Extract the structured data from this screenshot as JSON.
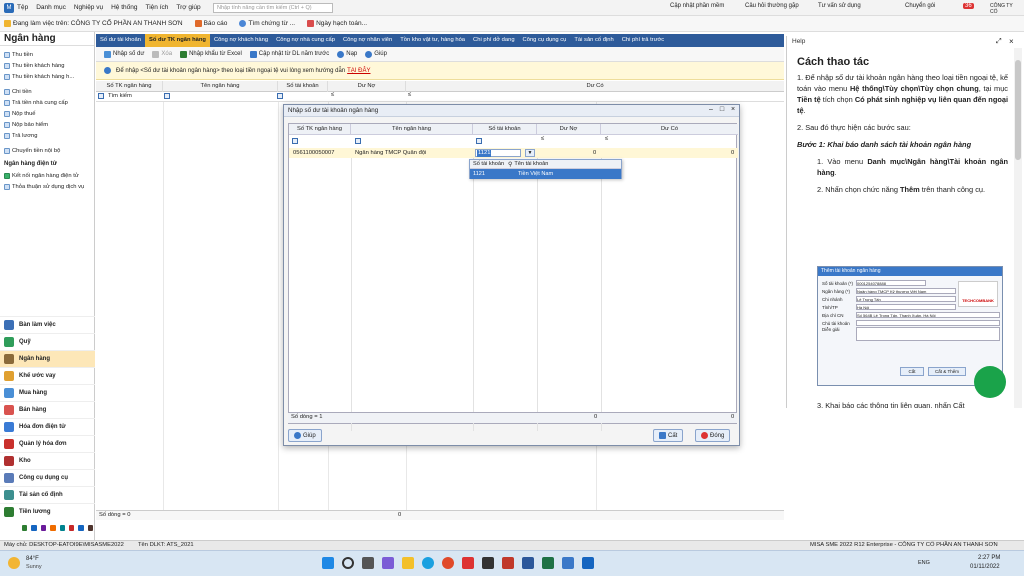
{
  "topbar": {
    "menu": [
      "Tệp",
      "Danh mục",
      "Nghiệp vụ",
      "Hệ thống",
      "Tiện ích",
      "Trợ giúp"
    ],
    "search_placeholder": "Nhập tính năng cần tìm kiếm (Ctrl + Q)",
    "right": [
      "Cập nhật phần mềm",
      "Câu hỏi thường gặp",
      "Tư vấn sử dụng",
      "Chuyển gói"
    ],
    "notif_count": "36",
    "company_short": "CÔNG TY CỔ"
  },
  "toolbar": {
    "working_company": "Đang làm việc trên: CÔNG TY CỔ PHẦN AN THANH SƠN",
    "report": "Báo cáo",
    "search_func": "Tìm chứng từ ...",
    "period": "Ngày hạch toán..."
  },
  "sidebar": {
    "title": "Ngân hàng",
    "items": [
      "Thu tiền",
      "Thu tiền khách hàng",
      "Thu tiền khách hàng h..."
    ],
    "items2": [
      "Chi tiền",
      "Trả tiền nhà cung cấp",
      "Nộp thuế",
      "Nộp bảo hiểm",
      "Trả lương"
    ],
    "items3": [
      "Chuyển tiền nội bộ"
    ],
    "section": "Ngân hàng điện tử",
    "items4": [
      "Kết nối ngân hàng điện tử",
      "Thỏa thuận sử dụng dịch vụ"
    ],
    "nav": [
      "Bàn làm việc",
      "Quỹ",
      "Ngân hàng",
      "Khế ước vay",
      "Mua hàng",
      "Bán hàng",
      "Hóa đơn điện tử",
      "Quản lý hóa đơn",
      "Kho",
      "Công cụ dụng cụ",
      "Tài sản cố định",
      "Tiền lương"
    ]
  },
  "tabs": [
    "Số dư tài khoản",
    "Số dư TK ngân hàng",
    "Công nợ khách hàng",
    "Công nợ nhà cung cấp",
    "Công nợ nhân viên",
    "Tồn kho vật tư, hàng hóa",
    "Chi phí dở dang",
    "Công cụ dụng cụ",
    "Tài sản cố định",
    "Chi phí trả trước"
  ],
  "subtool": [
    "Nhập số dư",
    "Xóa",
    "Nhập khẩu từ Excel",
    "Cập nhật từ DL năm trước",
    "Nạp",
    "Giúp"
  ],
  "notice": {
    "text": "Để nhập <Số dư tài khoản ngân hàng> theo loại tiền ngoại tệ vui lòng xem hướng dẫn",
    "link": "TẠI ĐÂY"
  },
  "maingrid": {
    "headers": [
      "Số TK ngân hàng",
      "Tên ngân hàng",
      "Số tài khoản",
      "Dư Nợ",
      "Dư Có"
    ],
    "filter_label": "Tìm kiếm",
    "footer": "Số dòng = 0",
    "footer_total": "0"
  },
  "dialog": {
    "title": "Nhập số dư tài khoản ngân hàng",
    "headers": [
      "Số TK ngân hàng",
      "Tên ngân hàng",
      "Số tài khoản",
      "Dư Nợ",
      "Dư Có"
    ],
    "row": {
      "acct_no": "0561100050007",
      "bank": "Ngân hàng TMCP Quân đội",
      "ledger": "1121",
      "debit": "0",
      "credit": "0"
    },
    "dropdown": {
      "col1": "Số tài khoản",
      "col2": "Tên tài khoản",
      "row_code": "1121",
      "row_name": "Tiền Việt Nam"
    },
    "footer": "Số dòng = 1",
    "foot_debit": "0",
    "foot_credit": "0",
    "help_btn": "Giúp",
    "save_btn": "Cất",
    "close_btn": "Đóng"
  },
  "help": {
    "header": "Help",
    "title": "Cách thao tác",
    "p1a": "1. Để nhập số dư tài khoản ngân hàng theo loại tiền ngoại tệ, kế toán vào menu ",
    "p1b": "Hệ thống\\Tùy chọn\\Tùy chọn chung",
    "p1c": ", tại mục ",
    "p1d": "Tiền tệ",
    "p1e": " tích chọn ",
    "p1f": "Có phát sinh nghiệp vụ liên quan đến ngoại tệ",
    "p2": "2. Sau đó thực hiện các bước sau:",
    "step1": "Bước 1: Khai báo danh sách tài khoản ngân hàng",
    "s1a": "1. Vào menu ",
    "s1b": "Danh mục\\Ngân hàng\\Tài khoản ngân hàng",
    "s2a": "2. Nhấn chọn chức năng ",
    "s2b": "Thêm",
    "s2c": " trên thanh công cụ.",
    "cut": "3. Khai báo các thông tin liên quan, nhấn Cất",
    "shot_title": "Thêm tài khoản ngân hàng",
    "shot_fields": [
      "Số tài khoản (*)",
      "Ngân hàng (*)",
      "Chi nhánh",
      "Tỉnh/TP",
      "Địa chỉ CN",
      "Chủ tài khoản",
      "Diễn giải"
    ],
    "shot_values": [
      "0001254078888",
      "Ngân hàng TMCP Kỹ thương Việt Nam",
      "Lê Trọng Tấn",
      "Hà Nội",
      "Số 564B Lê Trọng Tấn, Thanh Xuân, Hà Nội",
      "",
      ""
    ],
    "shot_bank": "TECHCOMBANK",
    "shot_btns": [
      "Cất",
      "Cất & Thêm"
    ]
  },
  "status": {
    "server": "Máy chủ: DESKTOP-EATOI9E\\MISASME2022",
    "db": "Tên DLKT: ATS_2021",
    "product": "MISA SME 2022 R12 Enterprise - CÔNG TY CỔ PHẦN AN THANH SƠN"
  },
  "taskbar": {
    "temp": "84°F",
    "weather": "Sunny",
    "lang": "ENG",
    "time": "2:27 PM",
    "date": "01/11/2022",
    "search": "Search"
  },
  "colors": {
    "tab_bar": "#2e5b9a",
    "tab_active": "#f0b530",
    "nav_active": "#fde7b8",
    "selection": "#3a78c8"
  }
}
